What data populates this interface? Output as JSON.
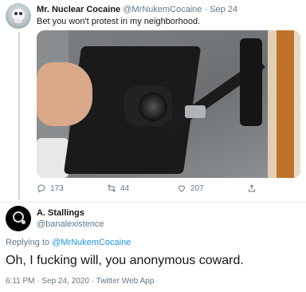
{
  "tweet1": {
    "name": "Mr. Nuclear Cocaine",
    "handle": "@MrNukemCocaine",
    "separator": "·",
    "date": "Sep 24",
    "text": "Bet you won't protest in my neighborhood.",
    "actions": {
      "reply_count": "173",
      "retweet_count": "44",
      "like_count": "207"
    }
  },
  "reply": {
    "name": "A. Stallings",
    "handle": "@banalexistence",
    "replying_prefix": "Replying to",
    "replying_to": "@MrNukemCocaine",
    "text": "Oh, I fucking will, you anonymous coward.",
    "time": "6:11 PM",
    "separator": "·",
    "date": "Sep 24, 2020",
    "source": "Twitter Web App"
  },
  "colors": {
    "link": "#1b95e0",
    "secondary_text": "#657786",
    "primary_text": "#14171a"
  },
  "icons": [
    "reply-icon",
    "retweet-icon",
    "like-icon",
    "share-icon"
  ]
}
